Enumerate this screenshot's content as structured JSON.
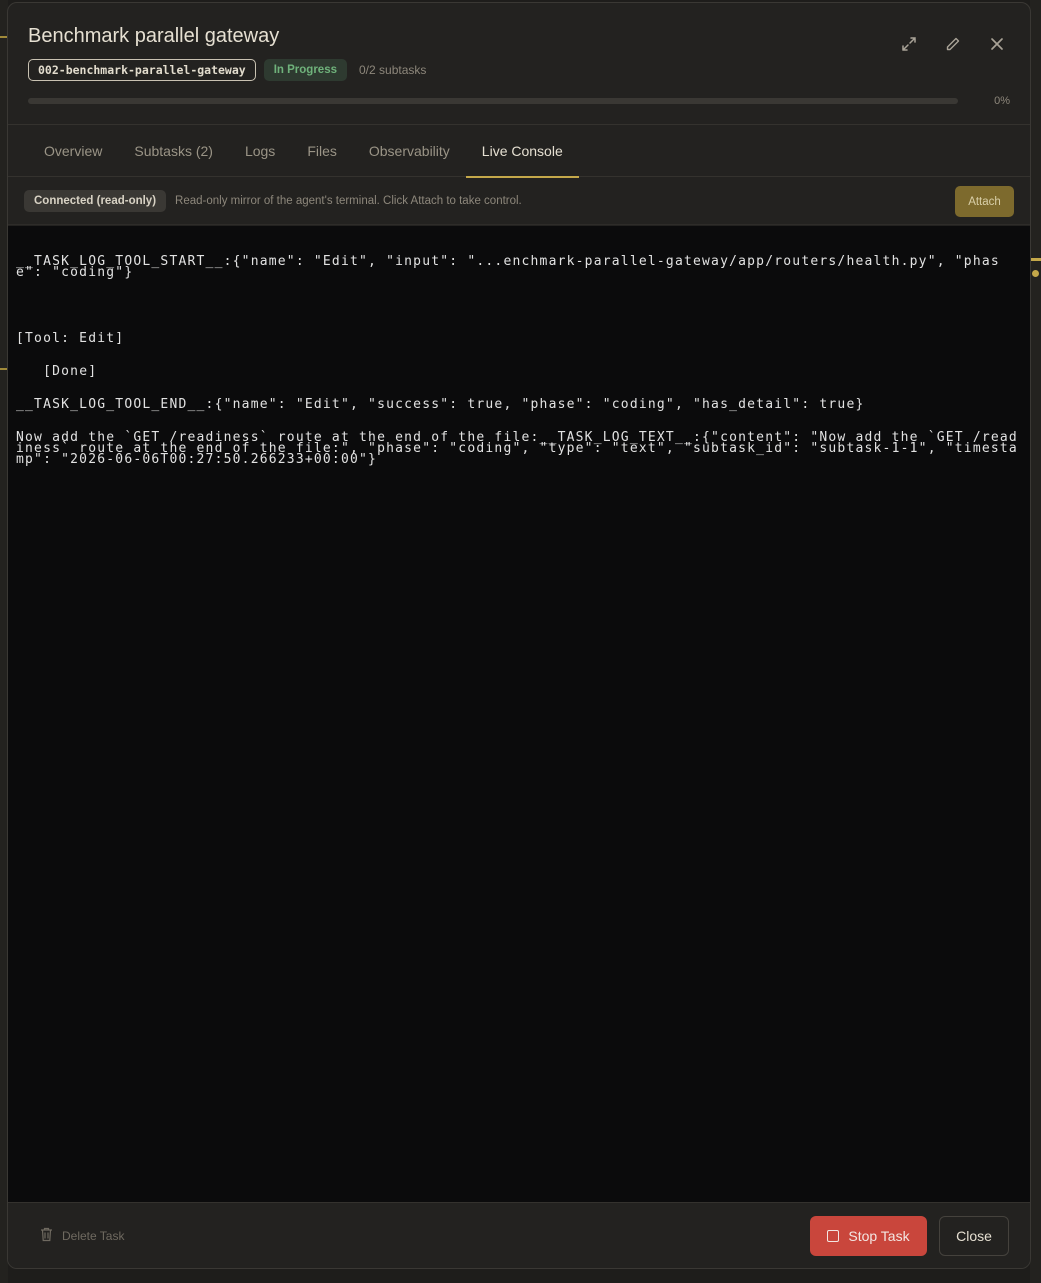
{
  "modal": {
    "title": "Benchmark parallel gateway",
    "slug": "002-benchmark-parallel-gateway",
    "status": "In Progress",
    "subtasks_summary": "0/2 subtasks",
    "progress_percent": 0,
    "progress_label": "0%",
    "icons": [
      "expand-icon",
      "edit-icon",
      "close-icon"
    ]
  },
  "tabs": [
    {
      "label": "Overview"
    },
    {
      "label": "Subtasks (2)"
    },
    {
      "label": "Logs"
    },
    {
      "label": "Files"
    },
    {
      "label": "Observability"
    },
    {
      "label": "Live Console",
      "active": true
    }
  ],
  "console": {
    "connection_label": "Connected (read-only)",
    "description": "Read-only mirror of the agent's terminal. Click Attach to take control.",
    "attach_label": "Attach",
    "lines": [
      "__TASK_LOG_TOOL_START__:{\"name\": \"Edit\", \"input\": \"...enchmark-parallel-gateway/app/routers/health.py\", \"phase\": \"coding\"}",
      "",
      "[Tool: Edit]",
      "   [Done]",
      "__TASK_LOG_TOOL_END__:{\"name\": \"Edit\", \"success\": true, \"phase\": \"coding\", \"has_detail\": true}",
      "Now add the `GET /readiness` route at the end of the file:__TASK_LOG_TEXT__:{\"content\": \"Now add the `GET /readiness` route at the end of the file:\", \"phase\": \"coding\", \"type\": \"text\", \"subtask_id\": \"subtask-1-1\", \"timestamp\": \"2026-06-06T00:27:50.266233+00:00\"}"
    ]
  },
  "footer": {
    "delete_label": "Delete Task",
    "stop_label": "Stop Task",
    "close_label": "Close"
  },
  "colors": {
    "accent": "#c4a84a",
    "status_green": "#6fb27b",
    "danger": "#c9463c"
  }
}
